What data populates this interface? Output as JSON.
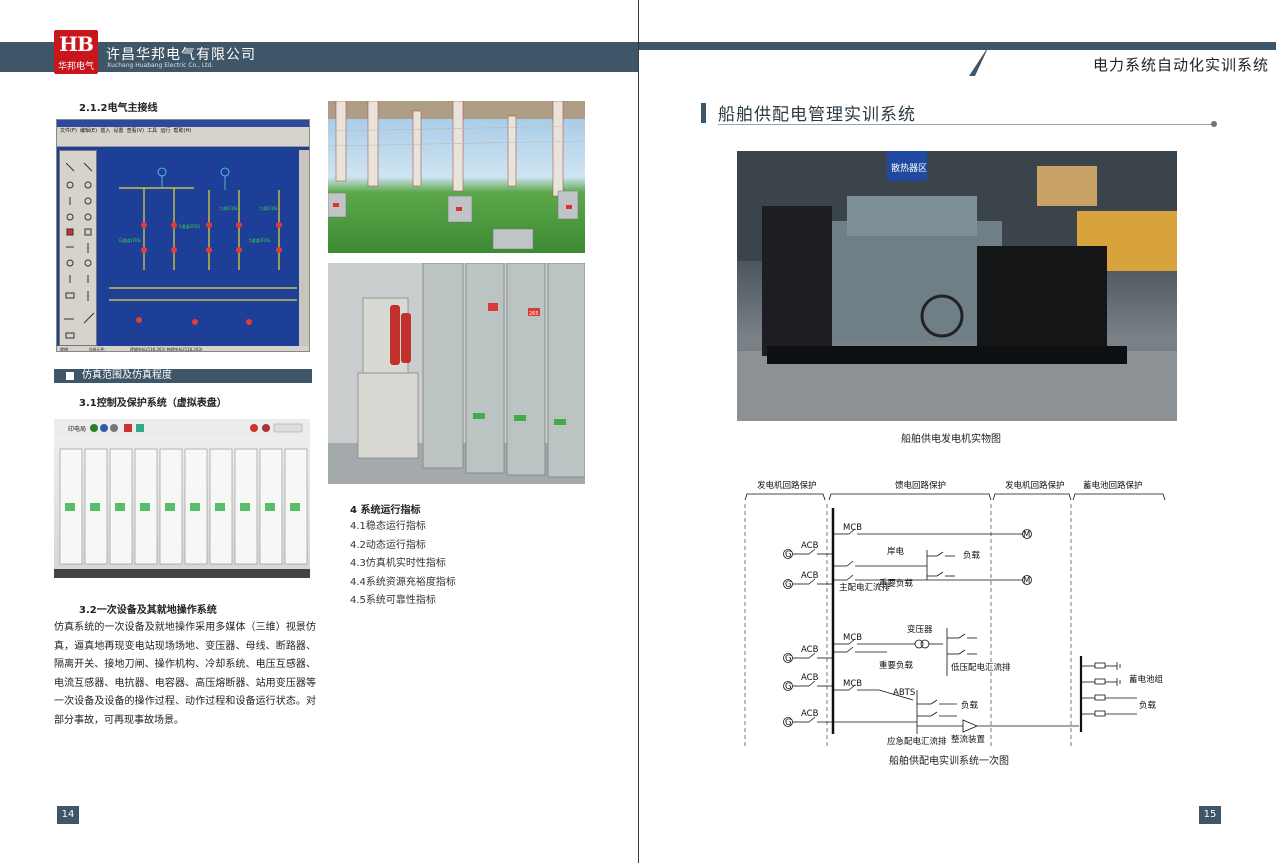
{
  "left_page": {
    "logo": {
      "mark": "HB",
      "name_cn": "华邦电气"
    },
    "company": {
      "name_cn": "许昌华邦电气有限公司",
      "name_en": "Xuchang Huabang Electric Co., Ltd."
    },
    "section_212": "2.1.2电气主接线",
    "app_screenshot": {
      "menus": [
        "文件(F)",
        "编辑(E)",
        "插入",
        "设置",
        "查看(V)",
        "工具",
        "运行",
        "帮助(H)"
      ],
      "status": [
        "就绪",
        "当前元件:",
        "逻辑坐标(518,263) 物理坐标(518,263)"
      ],
      "labels": [
        "六通1FDS",
        "六通2FDS",
        "5道道2FDS",
        "G道道1FDS",
        "5道道2FDS"
      ]
    },
    "section_3": "仿真范围及仿真程度",
    "section_31": "3.1控制及保护系统（虚拟表盘）",
    "panel_toolbar_label": "印电局",
    "section_32": "3.2一次设备及其就地操作系统",
    "paragraph": "仿真系统的一次设备及就地操作采用多媒体（三维）视景仿真，逼真地再现变电站现场场地、变压器、母线、断路器、隔离开关、接地刀闸、操作机构、冷却系统、电压互感器、电流互感器、电抗器、电容器、高压熔断器、站用变压器等一次设备及设备的操作过程、动作过程和设备运行状态。对部分事故，可再现事故场景。",
    "section_4": "4 系统运行指标",
    "list": [
      "4.1稳态运行指标",
      "4.2动态运行指标",
      "4.3仿真机实时性指标",
      "4.4系统资源充裕度指标",
      "4.5系统可靠性指标"
    ],
    "cabinet_labels": [
      "265"
    ],
    "page_number": "14"
  },
  "right_page": {
    "header_title": "电力系统自动化实训系统",
    "section_title": "船舶供配电管理实训系统",
    "photo_sign": "散热器区",
    "photo_caption": "船舶供电发电机实物图",
    "diagram": {
      "zones": [
        "发电机回路保护",
        "馈电回路保护",
        "发电机回路保护",
        "蓄电池回路保护"
      ],
      "generator_symbol": "G",
      "motor_symbol": "M",
      "breakers": [
        "MCB",
        "ACB",
        "ACB",
        "MCB",
        "ACB",
        "MCB",
        "ACB",
        "ABTS",
        "ACB"
      ],
      "main_bus": "主配电汇流排",
      "labels": {
        "shore_power": "岸电",
        "load": "负载",
        "important_load": "重要负载",
        "transformer": "变压器",
        "low_voltage_bus": "低压配电汇流排",
        "emergency_bus": "应急配电汇流排",
        "rectifier": "整流装置",
        "battery": "蓄电池组"
      },
      "caption": "船舶供配电实训系统一次图"
    },
    "page_number": "15"
  },
  "colors": {
    "header": "#3f5668",
    "logo": "#c9161d",
    "app_canvas": "#1e3f98",
    "diagram_line": "#111111"
  }
}
